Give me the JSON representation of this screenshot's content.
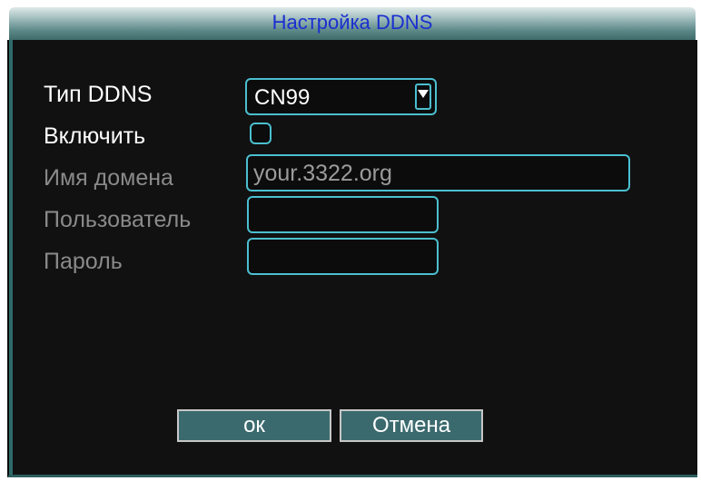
{
  "dialog": {
    "title": "Настройка DDNS"
  },
  "form": {
    "ddns_type_label": "Тип DDNS",
    "ddns_type_value": "CN99",
    "enable_label": "Включить",
    "domain_label": "Имя домена",
    "domain_value": "your.3322.org",
    "user_label": "Пользователь",
    "user_value": "",
    "password_label": "Пароль",
    "password_value": ""
  },
  "buttons": {
    "ok": "ок",
    "cancel": "Отмена"
  },
  "colors": {
    "accent_border": "#4bbfcf",
    "title_text": "#1a2fd0",
    "button_fill": "#3b6a6e"
  }
}
